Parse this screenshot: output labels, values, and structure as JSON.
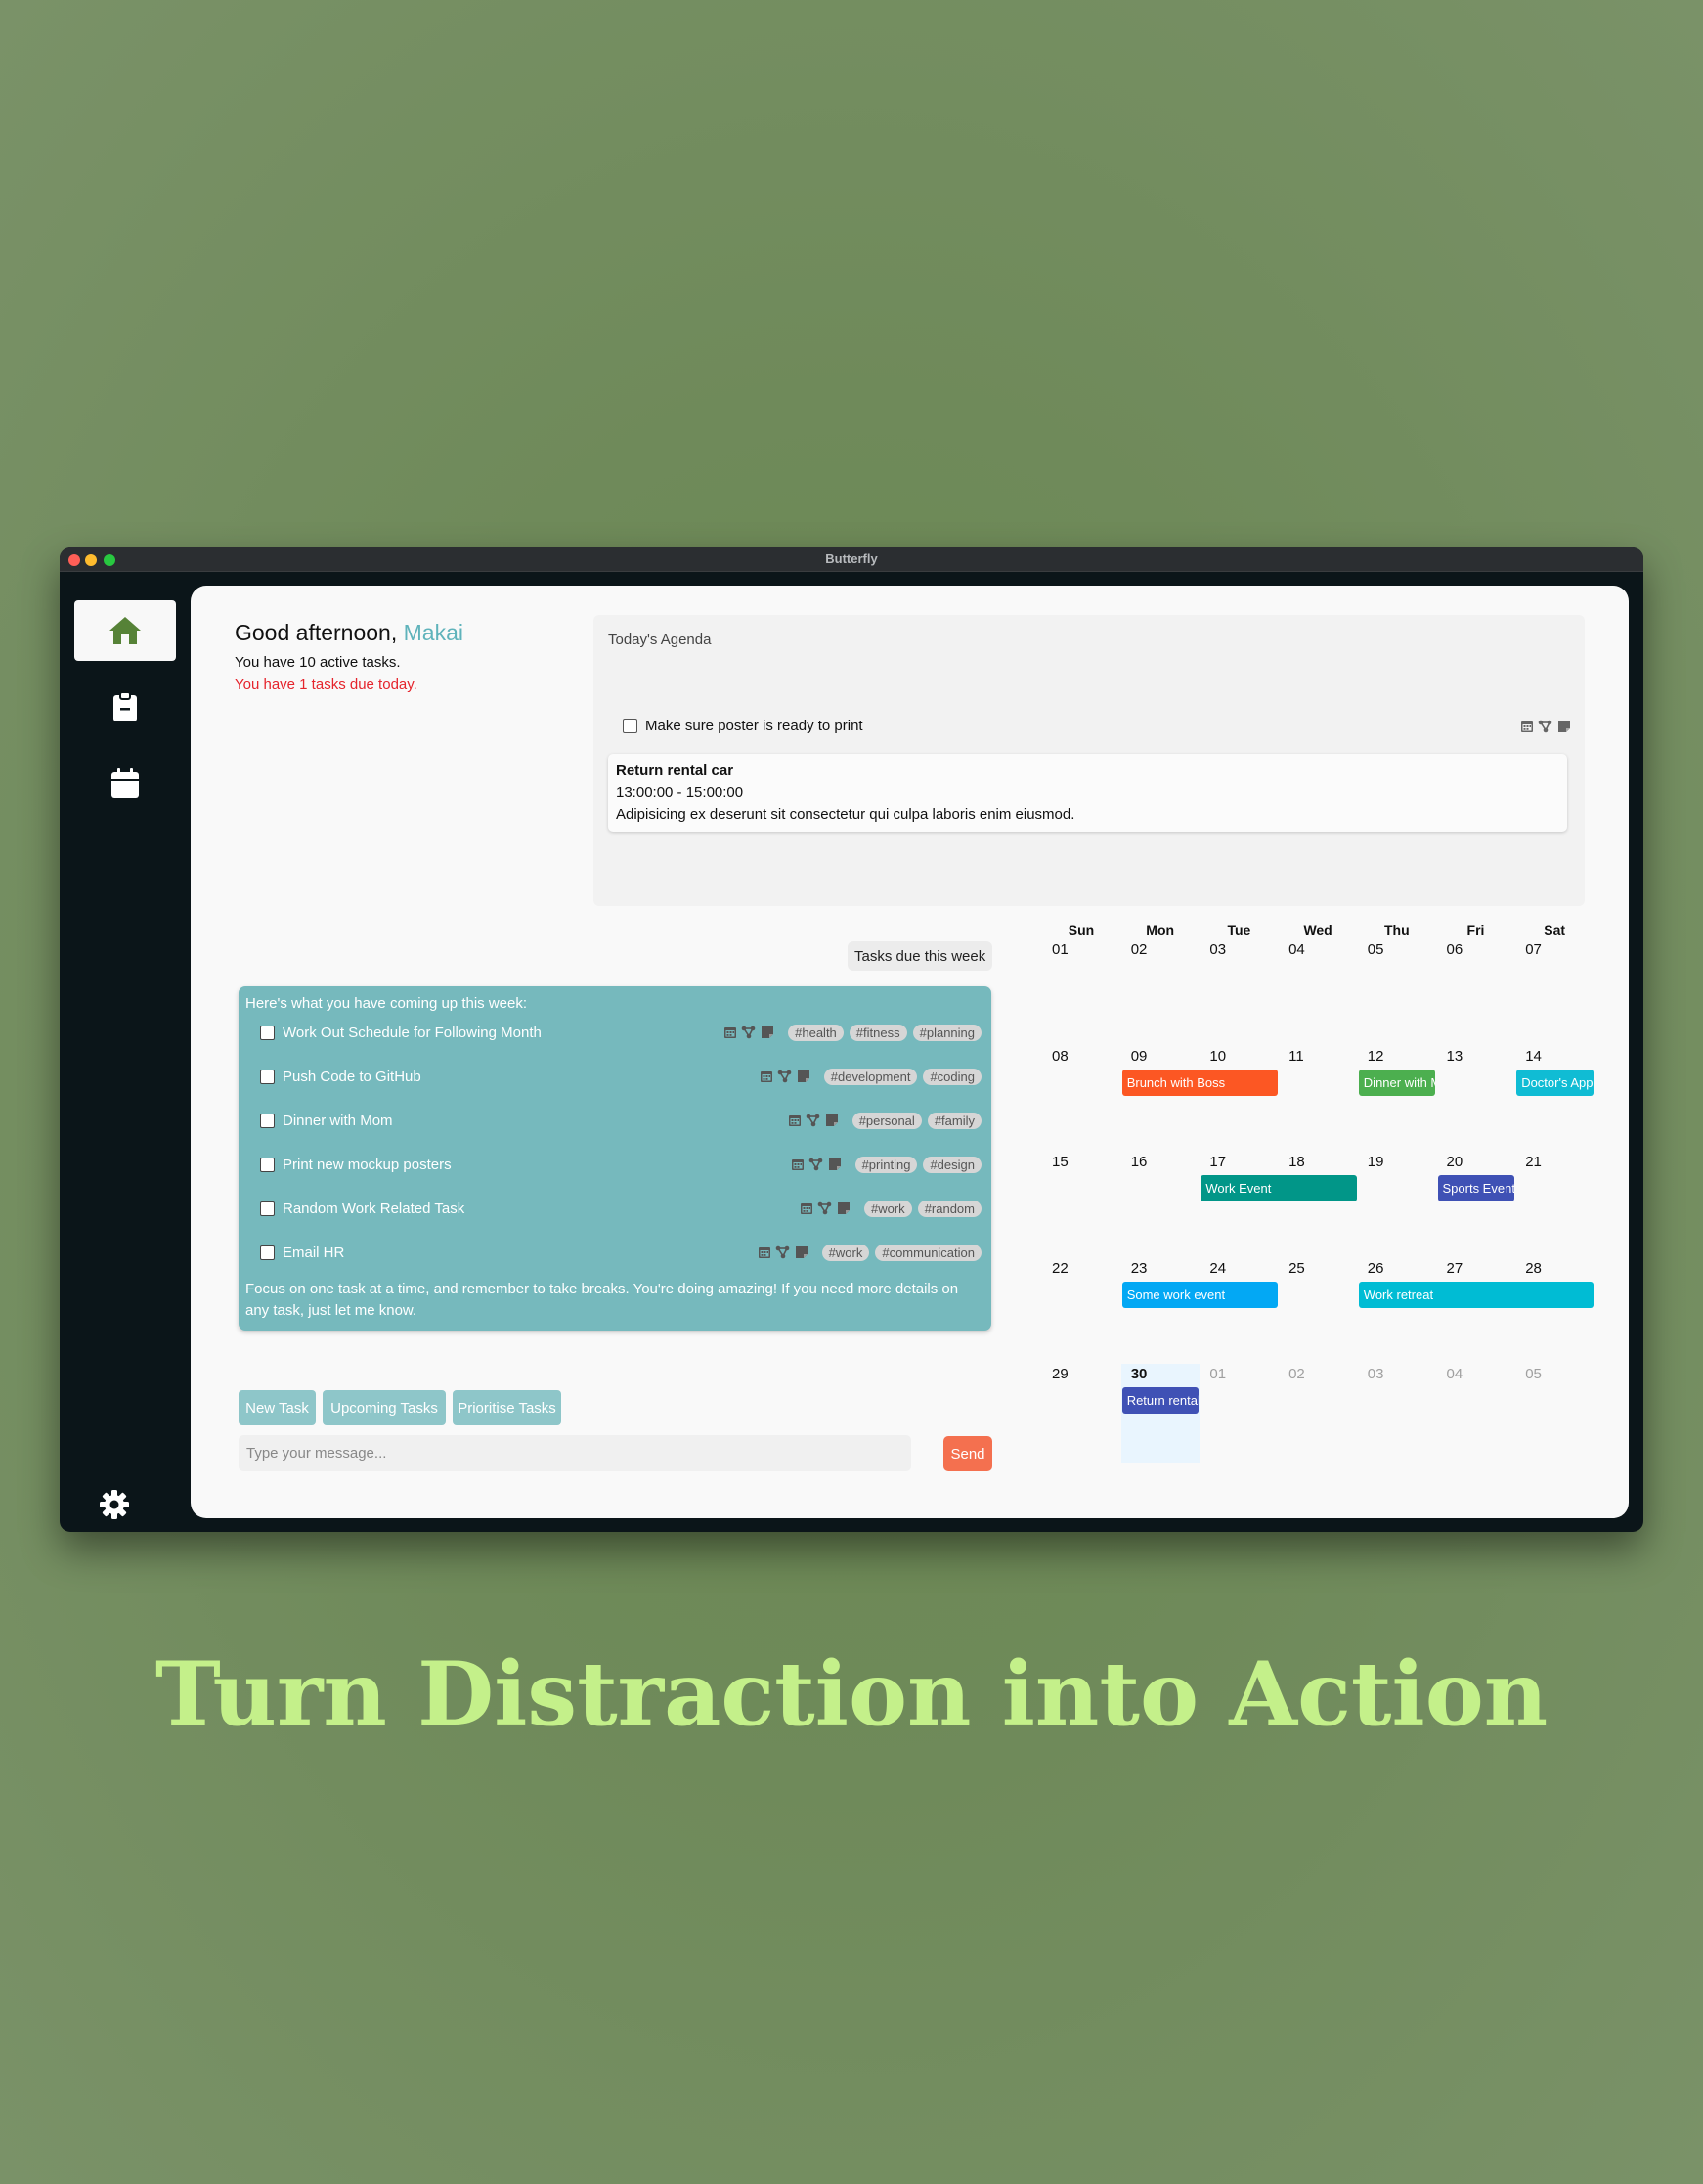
{
  "window": {
    "title": "Butterfly"
  },
  "sidebar": {
    "items": [
      {
        "name": "home",
        "icon": "home-icon",
        "active": true
      },
      {
        "name": "tasks",
        "icon": "clipboard-icon",
        "active": false
      },
      {
        "name": "calendar",
        "icon": "calendar-icon",
        "active": false
      }
    ],
    "settings_icon": "gear-icon"
  },
  "greeting": {
    "prefix": "Good afternoon, ",
    "name": "Makai",
    "active_tasks": "You have 10 active tasks.",
    "due_today": "You have 1 tasks due today."
  },
  "agenda": {
    "title": "Today's Agenda",
    "task": {
      "label": "Make sure poster is ready to print",
      "checked": false
    },
    "event": {
      "title": "Return rental car",
      "time": "13:00:00 - 15:00:00",
      "description": "Adipisicing ex deserunt sit consectetur qui culpa laboris enim eiusmod."
    }
  },
  "chat": {
    "user_message": "Tasks due this week",
    "bot": {
      "intro": "Here's what you have coming up this week:",
      "tasks": [
        {
          "label": "Work Out Schedule for Following Month",
          "tags": [
            "#health",
            "#fitness",
            "#planning"
          ]
        },
        {
          "label": "Push Code to GitHub",
          "tags": [
            "#development",
            "#coding"
          ]
        },
        {
          "label": "Dinner with Mom",
          "tags": [
            "#personal",
            "#family"
          ]
        },
        {
          "label": "Print new mockup posters",
          "tags": [
            "#printing",
            "#design"
          ]
        },
        {
          "label": "Random Work Related Task",
          "tags": [
            "#work",
            "#random"
          ]
        },
        {
          "label": "Email HR",
          "tags": [
            "#work",
            "#communication"
          ]
        }
      ],
      "outro": "Focus on one task at a time, and remember to take breaks. You're doing amazing! If you need more details on any task, just let me know."
    },
    "quick_actions": [
      "New Task",
      "Upcoming Tasks",
      "Prioritise Tasks"
    ],
    "input_placeholder": "Type your message...",
    "send_label": "Send"
  },
  "calendar": {
    "weekdays": [
      "Sun",
      "Mon",
      "Tue",
      "Wed",
      "Thu",
      "Fri",
      "Sat"
    ],
    "weeks": [
      [
        "01",
        "02",
        "03",
        "04",
        "05",
        "06",
        "07"
      ],
      [
        "08",
        "09",
        "10",
        "11",
        "12",
        "13",
        "14"
      ],
      [
        "15",
        "16",
        "17",
        "18",
        "19",
        "20",
        "21"
      ],
      [
        "22",
        "23",
        "24",
        "25",
        "26",
        "27",
        "28"
      ],
      [
        "29",
        "30",
        "01",
        "02",
        "03",
        "04",
        "05"
      ]
    ],
    "faded_from": {
      "week": 4,
      "day": 2
    },
    "today": {
      "week": 4,
      "day": 1
    },
    "events": [
      {
        "label": "Brunch with Boss",
        "week": 1,
        "start": 1,
        "span": 2,
        "color": "#fc5723"
      },
      {
        "label": "Dinner with Mom",
        "week": 1,
        "start": 4,
        "span": 1,
        "color": "#4caf4f"
      },
      {
        "label": "Doctor's Appointment",
        "week": 1,
        "start": 6,
        "span": 1,
        "color": "#10bcd4"
      },
      {
        "label": "Work Event",
        "week": 2,
        "start": 2,
        "span": 2,
        "color": "#019688"
      },
      {
        "label": "Sports Event",
        "week": 2,
        "start": 5,
        "span": 1,
        "color": "#3f51b5"
      },
      {
        "label": "Some work event",
        "week": 3,
        "start": 1,
        "span": 2,
        "color": "#03a8f4"
      },
      {
        "label": "Work retreat",
        "week": 3,
        "start": 4,
        "span": 3,
        "color": "#00bcd4"
      },
      {
        "label": "Return rental car",
        "week": 4,
        "start": 1,
        "span": 1,
        "color": "#3f51b5"
      }
    ]
  },
  "tagline": "Turn Distraction into Action",
  "colors": {
    "accent": "#76b9bd",
    "danger": "#e5242c",
    "send": "#f4704f",
    "tagline": "#c4f08a"
  }
}
